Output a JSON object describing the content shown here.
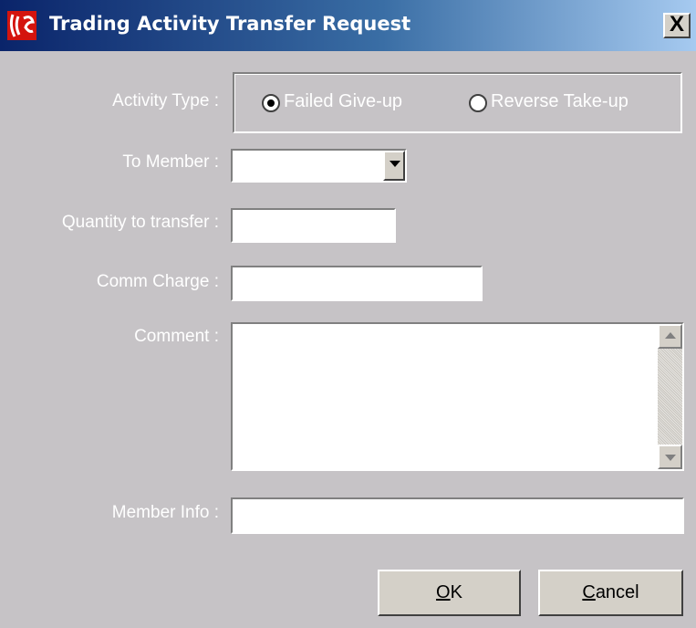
{
  "window": {
    "title": "Trading Activity Transfer Request",
    "close_label": "X"
  },
  "form": {
    "activity_type_label": "Activity Type :",
    "options": [
      {
        "label": "Failed Give-up",
        "checked": true
      },
      {
        "label": "Reverse Take-up",
        "checked": false
      }
    ],
    "to_member_label": "To Member :",
    "to_member_value": "",
    "quantity_label": "Quantity to transfer :",
    "quantity_value": "",
    "comm_charge_label": "Comm Charge :",
    "comm_charge_value": "",
    "comment_label": "Comment :",
    "comment_value": "",
    "member_info_label": "Member Info :",
    "member_info_value": ""
  },
  "buttons": {
    "ok_mnemonic": "O",
    "ok_rest": "K",
    "cancel_mnemonic": "C",
    "cancel_rest": "ancel"
  },
  "colors": {
    "title_start": "#0a246a",
    "title_end": "#a6caf0",
    "dialog_bg": "#c6c3c6",
    "app_icon": "#d4140e"
  }
}
